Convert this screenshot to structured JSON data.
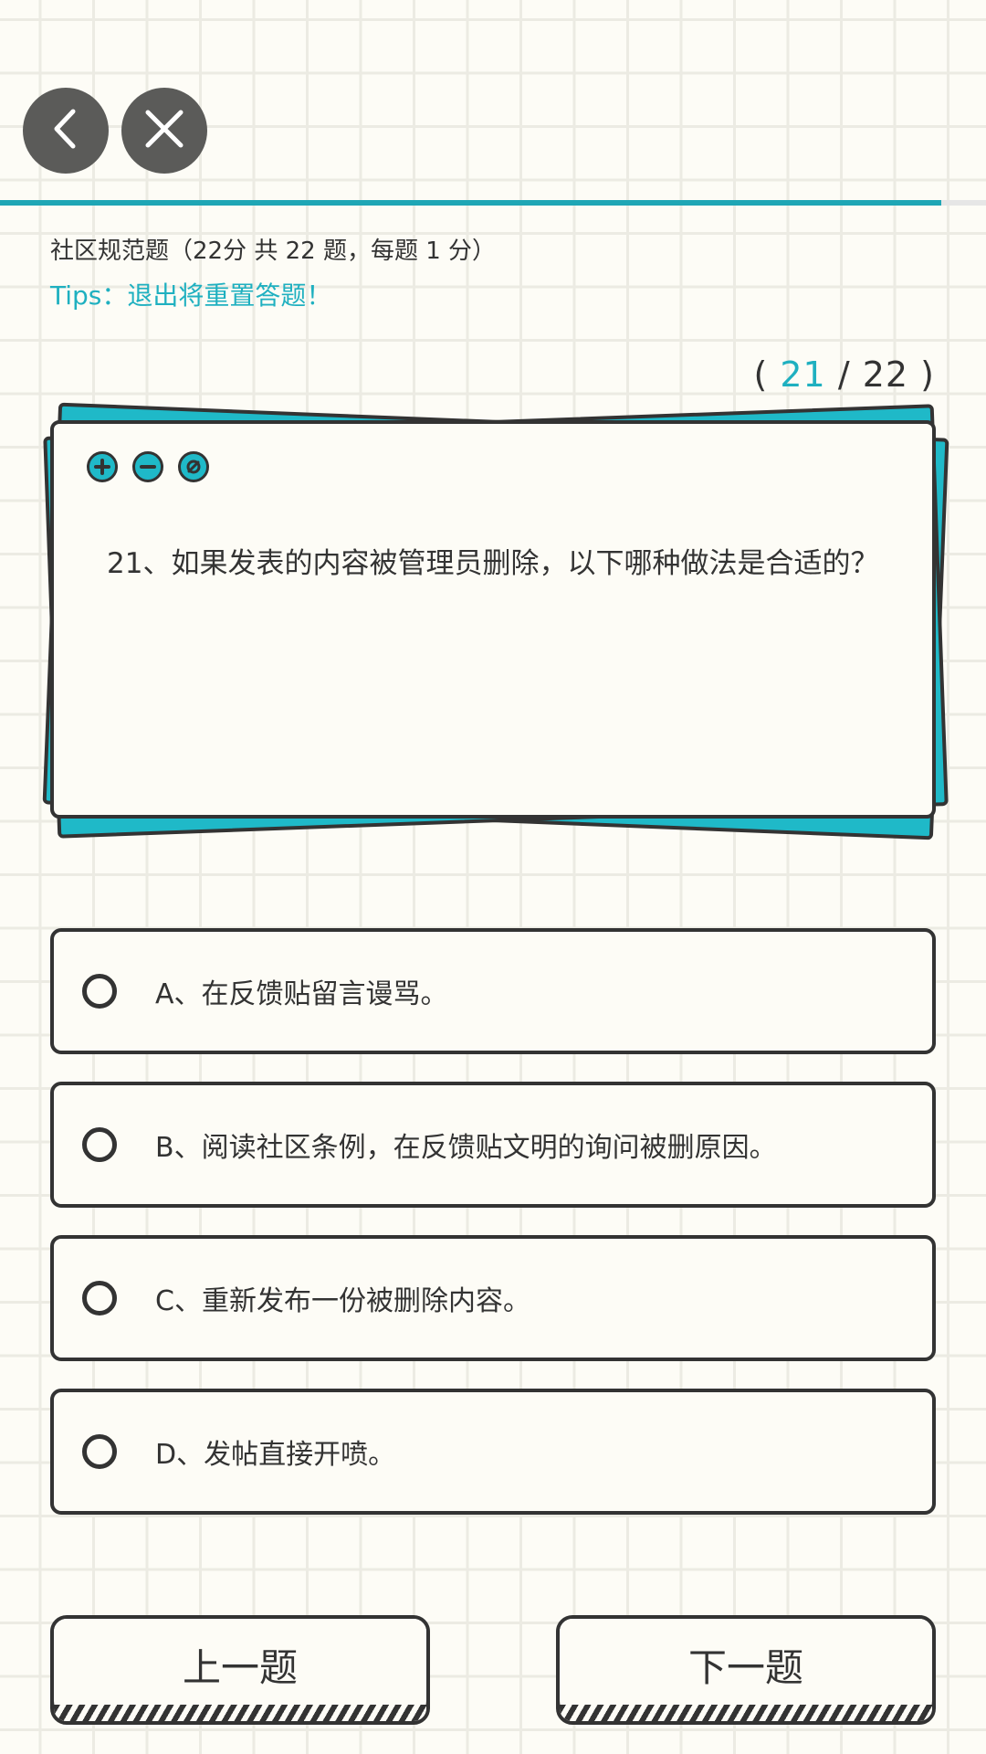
{
  "header": {
    "back_icon": "chevron-left-icon",
    "close_icon": "close-icon"
  },
  "progress": {
    "fraction": 0.9545,
    "color": "#1fa6b5"
  },
  "quiz": {
    "title": "社区规范题（22分 共 22 题，每题 1 分）",
    "tips": "Tips：退出将重置答题！",
    "counter_open": "(",
    "current": "21",
    "separator": "/",
    "total": "22",
    "counter_close": ")"
  },
  "card": {
    "icons": [
      "plus-circle-icon",
      "minus-circle-icon",
      "block-circle-icon"
    ],
    "question": "21、如果发表的内容被管理员删除，以下哪种做法是合适的？"
  },
  "options": [
    {
      "label": "A、在反馈贴留言谩骂。"
    },
    {
      "label": "B、阅读社区条例，在反馈贴文明的询问被删原因。"
    },
    {
      "label": "C、重新发布一份被删除内容。"
    },
    {
      "label": "D、发帖直接开喷。"
    }
  ],
  "nav": {
    "prev_label": "上一题",
    "next_label": "下一题"
  },
  "colors": {
    "accent": "#1fb0c0",
    "card_teal": "#1fb9c8",
    "ink": "#333333",
    "paper": "#fdfcf6",
    "button_dark": "#5b5b59"
  }
}
